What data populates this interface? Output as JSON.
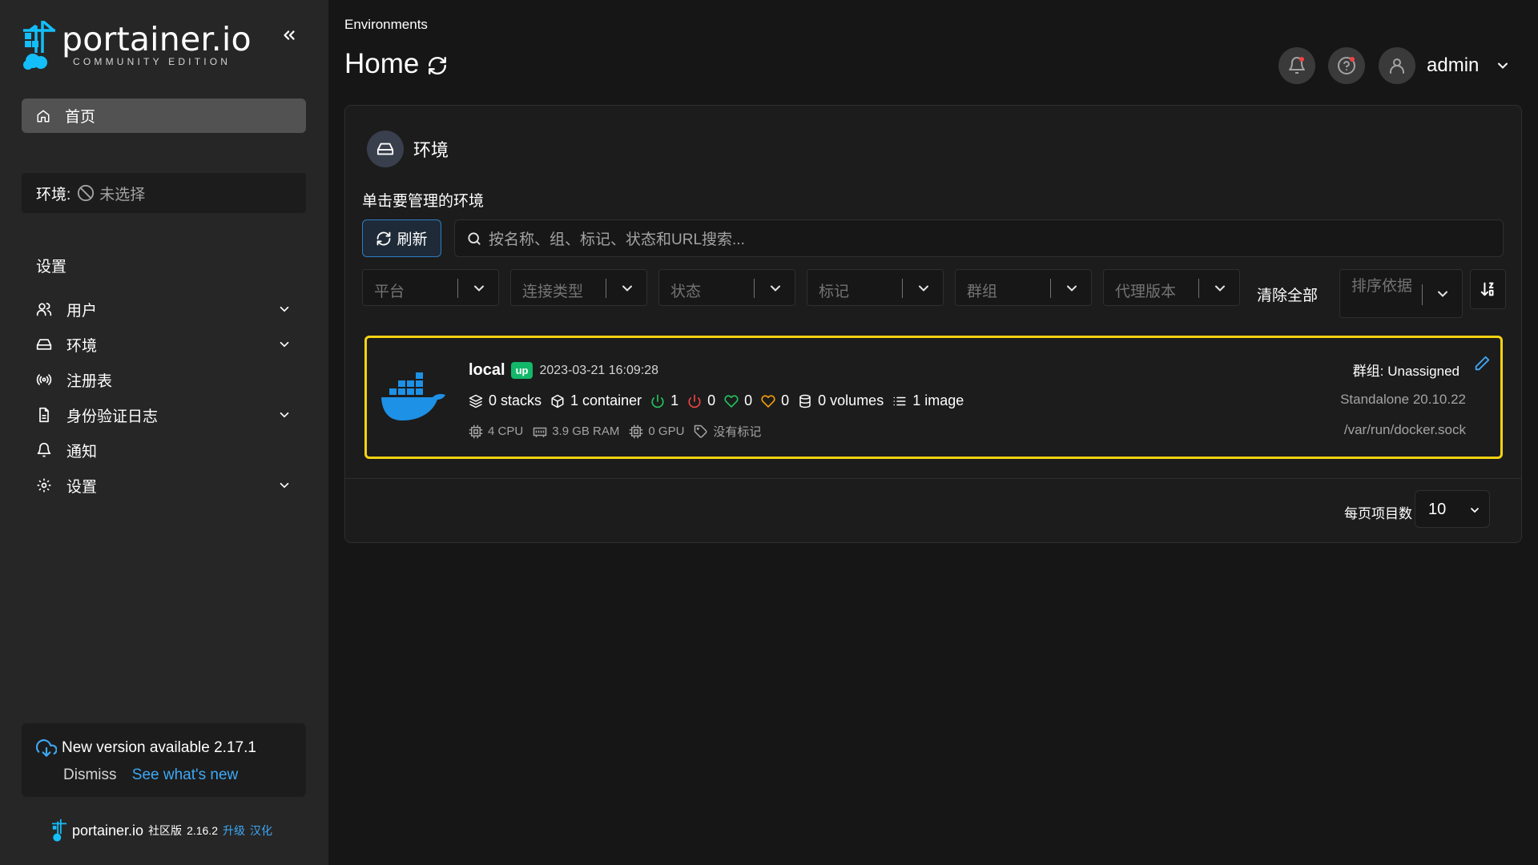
{
  "sidebar": {
    "logo_name": "portainer.io",
    "logo_edition": "COMMUNITY EDITION",
    "home_label": "首页",
    "env_label": "环境:",
    "env_value": "未选择",
    "section_title": "设置",
    "items": [
      {
        "label": "用户",
        "icon": "users-icon",
        "expandable": true
      },
      {
        "label": "环境",
        "icon": "hard-drive-icon",
        "expandable": true
      },
      {
        "label": "注册表",
        "icon": "radio-icon",
        "expandable": false
      },
      {
        "label": "身份验证日志",
        "icon": "file-text-icon",
        "expandable": true
      },
      {
        "label": "通知",
        "icon": "bell-icon",
        "expandable": false
      },
      {
        "label": "设置",
        "icon": "gear-icon",
        "expandable": true
      }
    ],
    "update": {
      "title": "New version available 2.17.1",
      "dismiss": "Dismiss",
      "whats_new": "See what's new"
    },
    "footer": {
      "name": "portainer.io",
      "edition": "社区版",
      "version": "2.16.2",
      "upgrade": "升级",
      "localize": "汉化"
    }
  },
  "header": {
    "breadcrumb": "Environments",
    "title": "Home",
    "user": "admin"
  },
  "panel": {
    "title": "环境",
    "subtitle": "单击要管理的环境",
    "refresh_label": "刷新",
    "search_placeholder": "按名称、组、标记、状态和URL搜索...",
    "filters": [
      "平台",
      "连接类型",
      "状态",
      "标记",
      "群组",
      "代理版本"
    ],
    "clear_all": "清除全部",
    "sort_label": "排序依据"
  },
  "environment": {
    "name": "local",
    "status": "up",
    "date": "2023-03-21 16:09:28",
    "stacks": "0 stacks",
    "containers": "1 container",
    "running": "1",
    "stopped": "0",
    "healthy": "0",
    "unhealthy": "0",
    "volumes": "0 volumes",
    "images": "1 image",
    "cpu": "4 CPU",
    "ram": "3.9 GB RAM",
    "gpu": "0 GPU",
    "tags": "没有标记",
    "group": "群组: Unassigned",
    "engine": "Standalone 20.10.22",
    "url": "/var/run/docker.sock"
  },
  "pagination": {
    "label": "每页项目数",
    "value": "10"
  },
  "colors": {
    "accent": "#3ea8f5",
    "selected_border": "#f6d313",
    "status_up": "#12b76a",
    "running": "#22c55e",
    "stopped": "#ef4444",
    "unhealthy": "#f59e0b"
  }
}
